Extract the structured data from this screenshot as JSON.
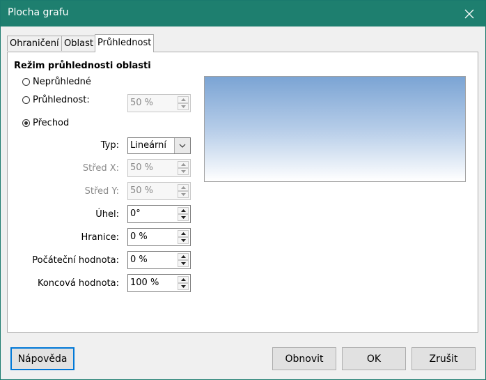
{
  "window": {
    "title": "Plocha grafu"
  },
  "tabs": [
    {
      "label": "Ohraničení"
    },
    {
      "label": "Oblast"
    },
    {
      "label": "Průhlednost"
    }
  ],
  "section": {
    "title": "Režim průhlednosti oblasti"
  },
  "modes": {
    "opaque": "Neprůhledné",
    "transparency": "Průhlednost:",
    "gradient": "Přechod",
    "selected": "gradient"
  },
  "transparency_value": "50 %",
  "gradient": {
    "type_label": "Typ:",
    "type_value": "Lineární",
    "center_x_label": "Střed X:",
    "center_x_value": "50 %",
    "center_y_label": "Střed Y:",
    "center_y_value": "50 %",
    "angle_label": "Úhel:",
    "angle_value": "0°",
    "border_label": "Hranice:",
    "border_value": "0 %",
    "start_label": "Počáteční hodnota:",
    "start_value": "0 %",
    "end_label": "Koncová hodnota:",
    "end_value": "100 %"
  },
  "buttons": {
    "help": "Nápověda",
    "reset": "Obnovit",
    "ok": "OK",
    "cancel": "Zrušit"
  },
  "colors": {
    "titlebar": "#1e7f6f",
    "preview_top": "#7ba4d4",
    "preview_bottom": "#ffffff"
  }
}
